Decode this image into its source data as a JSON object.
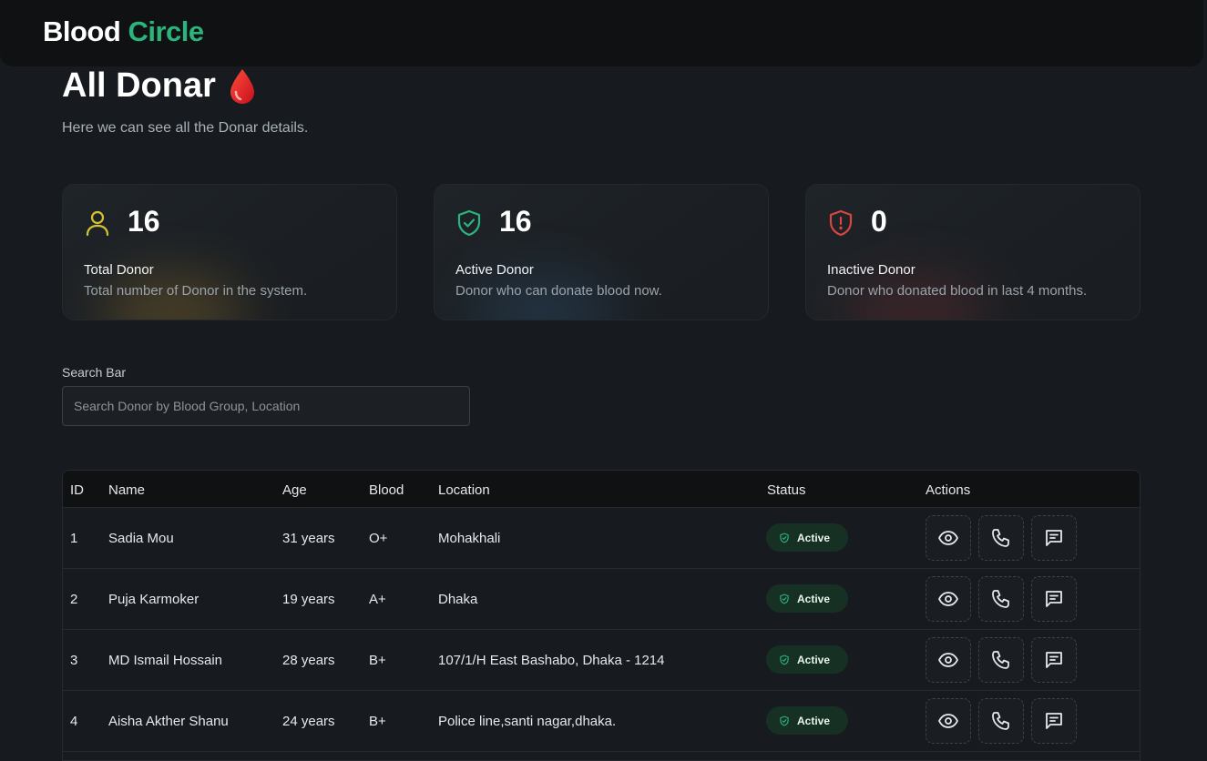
{
  "brand": {
    "part1": "Blood",
    "part2": "Circle"
  },
  "page": {
    "title": "All Donar",
    "subtitle": "Here we can see all the Donar details."
  },
  "stats": [
    {
      "count": "16",
      "title": "Total Donor",
      "desc": "Total number of Donor in the system.",
      "icon": "user-icon",
      "color": "#d6c330"
    },
    {
      "count": "16",
      "title": "Active Donor",
      "desc": "Donor who can donate blood now.",
      "icon": "shield-check-icon",
      "color": "#2bb57c"
    },
    {
      "count": "0",
      "title": "Inactive Donor",
      "desc": "Donor who donated blood in last 4 months.",
      "icon": "shield-alert-icon",
      "color": "#d9453f"
    }
  ],
  "search": {
    "label": "Search Bar",
    "placeholder": "Search Donor by Blood Group, Location",
    "value": ""
  },
  "table": {
    "headers": {
      "id": "ID",
      "name": "Name",
      "age": "Age",
      "blood": "Blood",
      "location": "Location",
      "status": "Status",
      "actions": "Actions"
    },
    "rows": [
      {
        "id": "1",
        "name": "Sadia Mou",
        "age": "31 years",
        "blood": "O+",
        "location": "Mohakhali",
        "status": "Active"
      },
      {
        "id": "2",
        "name": "Puja Karmoker",
        "age": "19 years",
        "blood": "A+",
        "location": "Dhaka",
        "status": "Active"
      },
      {
        "id": "3",
        "name": "MD Ismail Hossain",
        "age": "28 years",
        "blood": "B+",
        "location": "107/1/H East Bashabo, Dhaka - 1214",
        "status": "Active"
      },
      {
        "id": "4",
        "name": "Aisha Akther Shanu",
        "age": "24 years",
        "blood": "B+",
        "location": "Police line,santi nagar,dhaka.",
        "status": "Active"
      }
    ]
  },
  "colors": {
    "accent": "#2bb57c",
    "danger": "#d9453f",
    "warning": "#d6c330",
    "background": "#171b1f"
  }
}
